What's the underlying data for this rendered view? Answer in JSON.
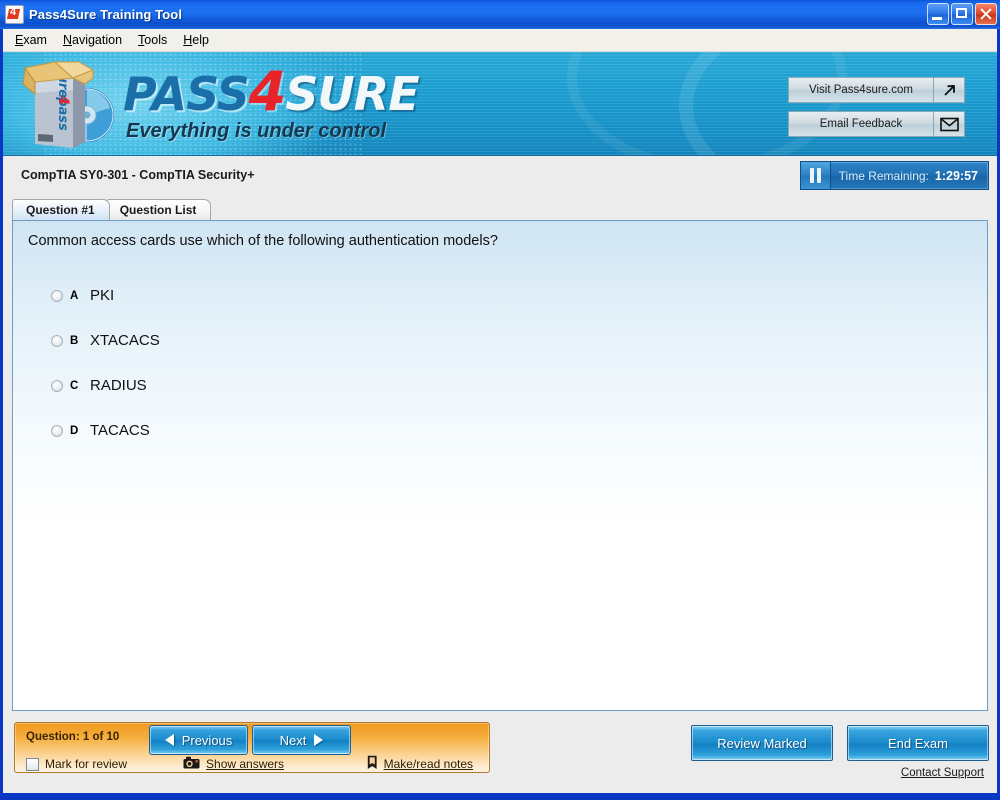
{
  "window": {
    "title": "Pass4Sure Training Tool",
    "icon": "pass4sure-logo-icon",
    "controls": {
      "minimize": "minimize-button",
      "maximize": "maximize-button",
      "close": "close-button"
    }
  },
  "menubar": {
    "items": [
      {
        "label": "Exam",
        "accel": "E"
      },
      {
        "label": "Navigation",
        "accel": "N"
      },
      {
        "label": "Tools",
        "accel": "T"
      },
      {
        "label": "Help",
        "accel": "H"
      }
    ]
  },
  "banner": {
    "logo_part1": "PASS",
    "logo_part2": "4",
    "logo_part3": "SURE",
    "tagline": "Everything is under control",
    "box_label": "pass4sure",
    "buttons": [
      {
        "label": "Visit Pass4sure.com",
        "icon": "external-link-icon"
      },
      {
        "label": "Email Feedback",
        "icon": "envelope-icon"
      }
    ]
  },
  "exam": {
    "title": "CompTIA SY0-301 - CompTIA Security+",
    "timer": {
      "label": "Time Remaining:",
      "value": "1:29:57",
      "pause_icon": "pause-icon"
    }
  },
  "tabs": [
    {
      "label": "Question #1",
      "active": true
    },
    {
      "label": "Question List",
      "active": false
    }
  ],
  "question": {
    "text": "Common access cards use which of the following authentication models?",
    "options": [
      {
        "letter": "A",
        "text": "PKI",
        "selected": false
      },
      {
        "letter": "B",
        "text": "XTACACS",
        "selected": false
      },
      {
        "letter": "C",
        "text": "RADIUS",
        "selected": false
      },
      {
        "letter": "D",
        "text": "TACACS",
        "selected": false
      }
    ]
  },
  "navigation": {
    "question_count": "Question: 1 of 10",
    "previous_label": "Previous",
    "next_label": "Next",
    "mark_for_review_label": "Mark for review",
    "show_answers_label": "Show answers",
    "show_answers_icon": "camera-icon",
    "notes_label": "Make/read notes",
    "notes_icon": "note-icon"
  },
  "actions": {
    "review_marked_label": "Review Marked",
    "end_exam_label": "End Exam",
    "contact_support_label": "Contact Support"
  },
  "colors": {
    "titlebar_blue": "#1b6ff2",
    "window_border": "#0a36c4",
    "banner_cyan": "#1b9ccf",
    "logo_red": "#e8232a",
    "logo_blue": "#1b6fa8",
    "panel_blue": "#cfe4f3",
    "orange_panel": "#f0981f",
    "button_blue": "#1d8ece",
    "chrome_gray": "#ececec"
  }
}
